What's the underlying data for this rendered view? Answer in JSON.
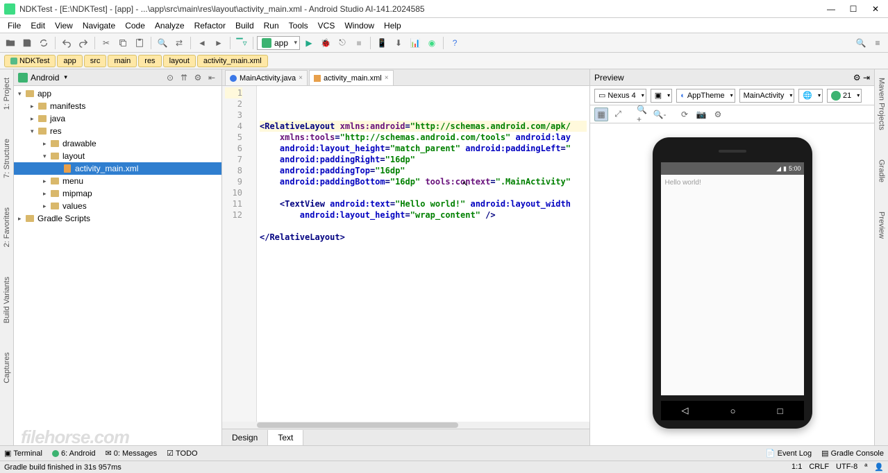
{
  "window": {
    "title": "NDKTest - [E:\\NDKTest] - [app] - ...\\app\\src\\main\\res\\layout\\activity_main.xml - Android Studio AI-141.2024585"
  },
  "menu": [
    "File",
    "Edit",
    "View",
    "Navigate",
    "Code",
    "Analyze",
    "Refactor",
    "Build",
    "Run",
    "Tools",
    "VCS",
    "Window",
    "Help"
  ],
  "run_config": "app",
  "breadcrumb": [
    "NDKTest",
    "app",
    "src",
    "main",
    "res",
    "layout",
    "activity_main.xml"
  ],
  "project": {
    "view_mode": "Android",
    "tree": {
      "root": "app",
      "children": [
        {
          "label": "manifests",
          "type": "folder"
        },
        {
          "label": "java",
          "type": "folder"
        },
        {
          "label": "res",
          "type": "folder",
          "expanded": true,
          "children": [
            {
              "label": "drawable",
              "type": "folder"
            },
            {
              "label": "layout",
              "type": "folder",
              "expanded": true,
              "children": [
                {
                  "label": "activity_main.xml",
                  "type": "file",
                  "selected": true
                }
              ]
            },
            {
              "label": "menu",
              "type": "folder"
            },
            {
              "label": "mipmap",
              "type": "folder"
            },
            {
              "label": "values",
              "type": "folder"
            }
          ]
        }
      ],
      "gradle": "Gradle Scripts"
    }
  },
  "editor": {
    "tabs": [
      {
        "label": "MainActivity.java",
        "icon": "java",
        "active": false
      },
      {
        "label": "activity_main.xml",
        "icon": "xml",
        "active": true
      }
    ],
    "footer_tabs": {
      "design": "Design",
      "text": "Text",
      "active": "Text"
    },
    "lines": [
      {
        "n": 1,
        "seg": [
          [
            "tag",
            "<RelativeLayout "
          ],
          [
            "ns",
            "xmlns:android"
          ],
          [
            "tag",
            "="
          ],
          [
            "str",
            "\"http://schemas.android.com/apk/"
          ]
        ]
      },
      {
        "n": 2,
        "seg": [
          [
            "plain",
            "    "
          ],
          [
            "ns",
            "xmlns:tools"
          ],
          [
            "tag",
            "="
          ],
          [
            "str",
            "\"http://schemas.android.com/tools\""
          ],
          [
            "plain",
            " "
          ],
          [
            "attr",
            "android:lay"
          ]
        ]
      },
      {
        "n": 3,
        "seg": [
          [
            "plain",
            "    "
          ],
          [
            "attr",
            "android:layout_height"
          ],
          [
            "tag",
            "="
          ],
          [
            "str",
            "\"match_parent\""
          ],
          [
            "plain",
            " "
          ],
          [
            "attr",
            "android:paddingLeft"
          ],
          [
            "tag",
            "="
          ],
          [
            "str",
            "\""
          ]
        ]
      },
      {
        "n": 4,
        "seg": [
          [
            "plain",
            "    "
          ],
          [
            "attr",
            "android:paddingRight"
          ],
          [
            "tag",
            "="
          ],
          [
            "str",
            "\"16dp\""
          ]
        ]
      },
      {
        "n": 5,
        "seg": [
          [
            "plain",
            "    "
          ],
          [
            "attr",
            "android:paddingTop"
          ],
          [
            "tag",
            "="
          ],
          [
            "str",
            "\"16dp\""
          ]
        ]
      },
      {
        "n": 6,
        "seg": [
          [
            "plain",
            "    "
          ],
          [
            "attr",
            "android:paddingBottom"
          ],
          [
            "tag",
            "="
          ],
          [
            "str",
            "\"16dp\""
          ],
          [
            "plain",
            " "
          ],
          [
            "ns",
            "tools:context"
          ],
          [
            "tag",
            "="
          ],
          [
            "str",
            "\".MainActivity\""
          ]
        ]
      },
      {
        "n": 7,
        "seg": []
      },
      {
        "n": 8,
        "seg": [
          [
            "plain",
            "    "
          ],
          [
            "tag",
            "<TextView "
          ],
          [
            "attr",
            "android:text"
          ],
          [
            "tag",
            "="
          ],
          [
            "str",
            "\"Hello world!\""
          ],
          [
            "plain",
            " "
          ],
          [
            "attr",
            "android:layout_width"
          ]
        ]
      },
      {
        "n": 9,
        "seg": [
          [
            "plain",
            "        "
          ],
          [
            "attr",
            "android:layout_height"
          ],
          [
            "tag",
            "="
          ],
          [
            "str",
            "\"wrap_content\""
          ],
          [
            "tag",
            " />"
          ]
        ]
      },
      {
        "n": 10,
        "seg": []
      },
      {
        "n": 11,
        "seg": [
          [
            "tag",
            "</RelativeLayout>"
          ]
        ]
      },
      {
        "n": 12,
        "seg": []
      }
    ]
  },
  "preview": {
    "title": "Preview",
    "device": "Nexus 4",
    "theme": "AppTheme",
    "activity": "MainActivity",
    "api": "21",
    "status_time": "5:00",
    "hello": "Hello world!"
  },
  "side_tabs_left": [
    "1: Project",
    "7: Structure",
    "2: Favorites",
    "Build Variants",
    "Captures"
  ],
  "side_tabs_right": [
    "Maven Projects",
    "Gradle",
    "Preview"
  ],
  "bottom_tabs": {
    "left": [
      "Terminal",
      "6: Android",
      "0: Messages",
      "TODO"
    ],
    "right": [
      "Event Log",
      "Gradle Console"
    ]
  },
  "status": {
    "message": "Gradle build finished in 31s 957ms",
    "pos": "1:1",
    "eol": "CRLF",
    "enc": "UTF-8",
    "context": "ª"
  },
  "watermark": "filehorse.com"
}
